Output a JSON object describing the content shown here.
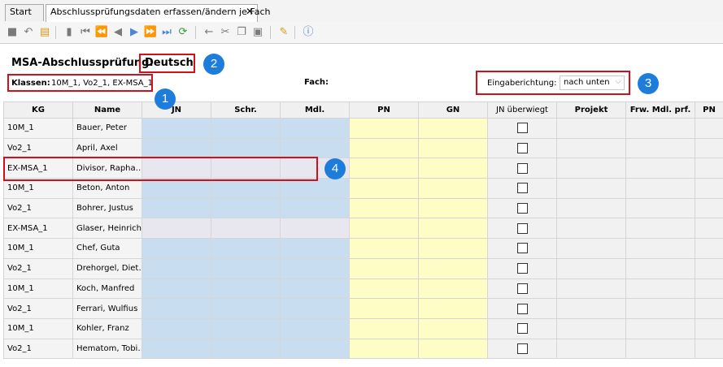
{
  "tabs": [
    {
      "label": "Start"
    },
    {
      "label": "Abschlussprüfungsdaten erfassen/ändern je Fach",
      "close": "✕"
    }
  ],
  "header": {
    "title": "MSA-Abschlussprüfung:",
    "subject": "Deutsch",
    "klassen_label": "Klassen:",
    "klassen_value": "10M_1, Vo2_1, EX-MSA_1",
    "fach_label": "Fach:",
    "eingabe_label": "Eingaberichtung:",
    "eingabe_value": "nach unten"
  },
  "callouts": [
    "1",
    "2",
    "3",
    "4"
  ],
  "table": {
    "columns": [
      "KG",
      "Name",
      "JN",
      "Schr.",
      "Mdl.",
      "PN",
      "GN",
      "JN überwiegt",
      "Projekt",
      "Frw. Mdl. prf.",
      "PN"
    ],
    "rows": [
      {
        "kg": "10M_1",
        "name": "Bauer, Peter"
      },
      {
        "kg": "Vo2_1",
        "name": "April, Axel"
      },
      {
        "kg": "EX-MSA_1",
        "name": "Divisor, Rapha…"
      },
      {
        "kg": "10M_1",
        "name": "Beton, Anton"
      },
      {
        "kg": "Vo2_1",
        "name": "Bohrer, Justus"
      },
      {
        "kg": "EX-MSA_1",
        "name": "Glaser, Heinrich"
      },
      {
        "kg": "10M_1",
        "name": "Chef, Guta"
      },
      {
        "kg": "Vo2_1",
        "name": "Drehorgel, Diet…"
      },
      {
        "kg": "10M_1",
        "name": "Koch, Manfred"
      },
      {
        "kg": "Vo2_1",
        "name": "Ferrari, Wulfius"
      },
      {
        "kg": "10M_1",
        "name": "Kohler, Franz"
      },
      {
        "kg": "Vo2_1",
        "name": "Hematom, Tobi…"
      }
    ]
  },
  "colors": {
    "accent_blue": "#1e7ddb",
    "highlight_red": "#d0101a",
    "cell_blue": "#c9ddf0",
    "cell_yellow": "#fefdc6"
  }
}
